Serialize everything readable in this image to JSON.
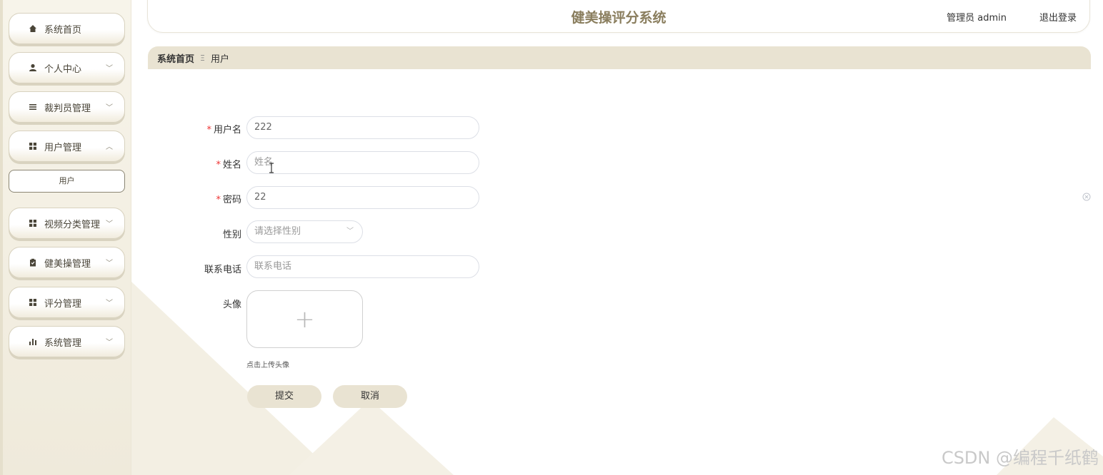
{
  "header": {
    "title": "健美操评分系统",
    "user": "管理员 admin",
    "logout": "退出登录"
  },
  "sidebar": {
    "items": [
      {
        "label": "系统首页",
        "icon": "home-icon"
      },
      {
        "label": "个人中心",
        "icon": "person-icon"
      },
      {
        "label": "裁判员管理",
        "icon": "list-icon"
      },
      {
        "label": "用户管理",
        "icon": "grid-icon"
      },
      {
        "label": "视频分类管理",
        "icon": "grid-icon"
      },
      {
        "label": "健美操管理",
        "icon": "clipboard-icon"
      },
      {
        "label": "评分管理",
        "icon": "grid-icon"
      },
      {
        "label": "系统管理",
        "icon": "bar-chart-icon"
      }
    ],
    "sub_item": "用户"
  },
  "breadcrumb": {
    "home": "系统首页",
    "separator": "Ξ",
    "current": "用户"
  },
  "form": {
    "username": {
      "label": "用户名",
      "value": "222",
      "required": true
    },
    "name": {
      "label": "姓名",
      "placeholder": "姓名",
      "required": true
    },
    "password": {
      "label": "密码",
      "value": "22",
      "required": true
    },
    "gender": {
      "label": "性别",
      "placeholder": "请选择性别"
    },
    "phone": {
      "label": "联系电话",
      "placeholder": "联系电话"
    },
    "avatar": {
      "label": "头像",
      "hint": "点击上传头像"
    },
    "required_mark": "*",
    "submit": "提交",
    "cancel": "取消"
  },
  "watermark": "CSDN @编程千纸鹤",
  "colors": {
    "accent": "#e9e3d2",
    "title": "#8a7e5e",
    "required": "#ee3333"
  }
}
